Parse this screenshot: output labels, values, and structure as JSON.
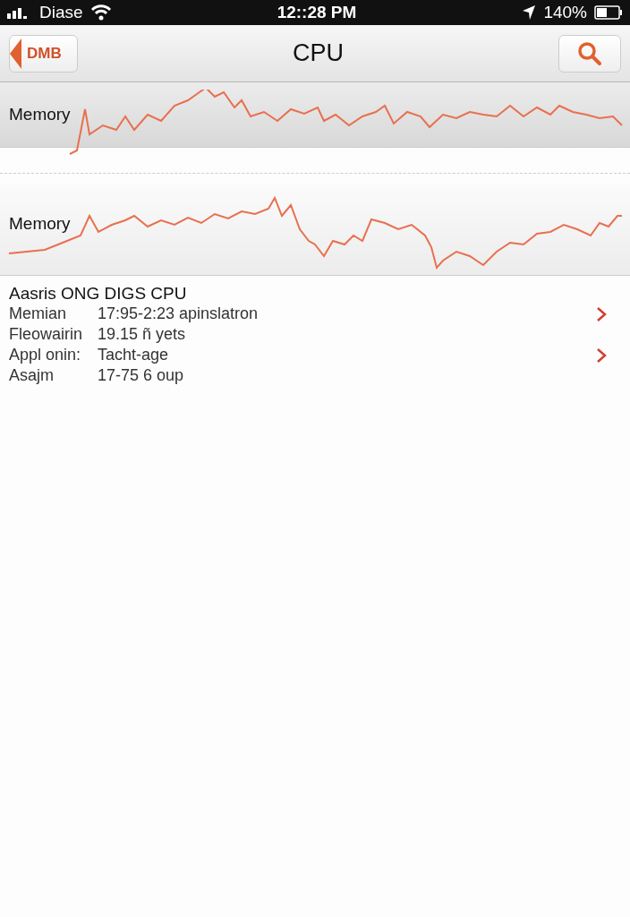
{
  "status_bar": {
    "carrier": "Diase",
    "time": "12::28 PM",
    "battery": "140%"
  },
  "nav_bar": {
    "back": "DMB",
    "title": "CPU"
  },
  "graphs": [
    {
      "label": "Memory",
      "kind": "shaded"
    },
    {
      "label": "Memory",
      "kind": "plain"
    }
  ],
  "details": {
    "heading": "Aasris ONG DIGS CPU",
    "rows": [
      {
        "label": "Memian",
        "value": "17:95-2:23 apinslatron",
        "chevron": true
      },
      {
        "label": "Fleowairin",
        "value": "19.15 ñ yets",
        "chevron": false
      },
      {
        "label": "Appl onin:",
        "value": "Tacht-age",
        "chevron": true
      },
      {
        "label": "Asajm",
        "value": "17-75 6 oup",
        "chevron": false
      }
    ]
  }
}
